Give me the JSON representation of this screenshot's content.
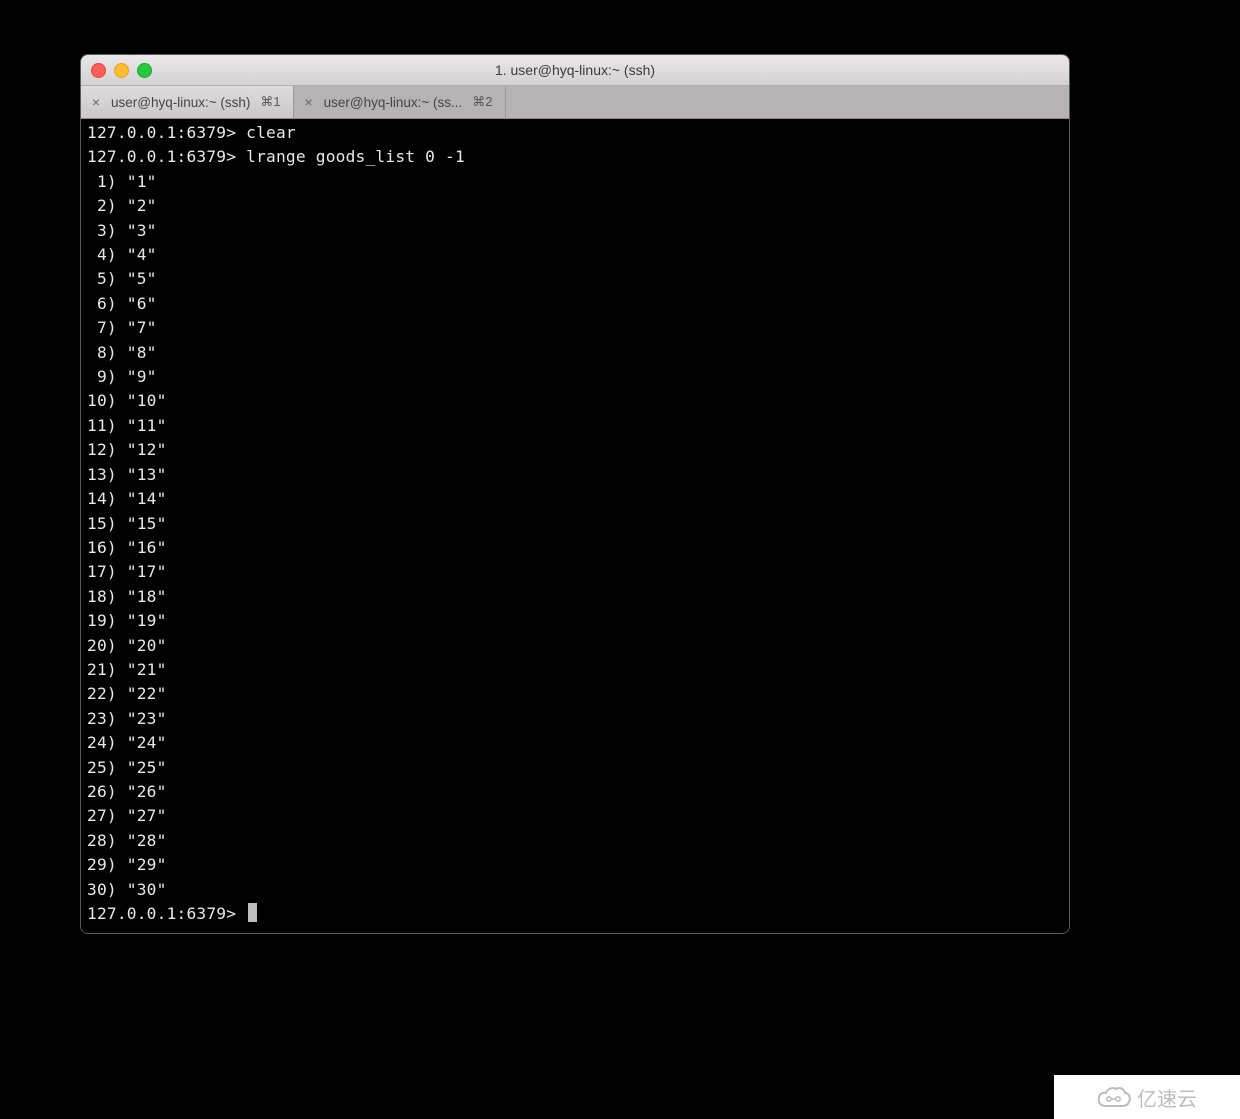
{
  "window": {
    "title": "1. user@hyq-linux:~ (ssh)"
  },
  "tabs": [
    {
      "label": "user@hyq-linux:~ (ssh)",
      "shortcut": "⌘1",
      "active": true
    },
    {
      "label": "user@hyq-linux:~ (ss...",
      "shortcut": "⌘2",
      "active": false
    }
  ],
  "terminal": {
    "prompt": "127.0.0.1:6379>",
    "commands": [
      {
        "cmd": "clear"
      },
      {
        "cmd": "lrange goods_list 0 -1"
      }
    ],
    "output": [
      {
        "idx": "1",
        "val": "1"
      },
      {
        "idx": "2",
        "val": "2"
      },
      {
        "idx": "3",
        "val": "3"
      },
      {
        "idx": "4",
        "val": "4"
      },
      {
        "idx": "5",
        "val": "5"
      },
      {
        "idx": "6",
        "val": "6"
      },
      {
        "idx": "7",
        "val": "7"
      },
      {
        "idx": "8",
        "val": "8"
      },
      {
        "idx": "9",
        "val": "9"
      },
      {
        "idx": "10",
        "val": "10"
      },
      {
        "idx": "11",
        "val": "11"
      },
      {
        "idx": "12",
        "val": "12"
      },
      {
        "idx": "13",
        "val": "13"
      },
      {
        "idx": "14",
        "val": "14"
      },
      {
        "idx": "15",
        "val": "15"
      },
      {
        "idx": "16",
        "val": "16"
      },
      {
        "idx": "17",
        "val": "17"
      },
      {
        "idx": "18",
        "val": "18"
      },
      {
        "idx": "19",
        "val": "19"
      },
      {
        "idx": "20",
        "val": "20"
      },
      {
        "idx": "21",
        "val": "21"
      },
      {
        "idx": "22",
        "val": "22"
      },
      {
        "idx": "23",
        "val": "23"
      },
      {
        "idx": "24",
        "val": "24"
      },
      {
        "idx": "25",
        "val": "25"
      },
      {
        "idx": "26",
        "val": "26"
      },
      {
        "idx": "27",
        "val": "27"
      },
      {
        "idx": "28",
        "val": "28"
      },
      {
        "idx": "29",
        "val": "29"
      },
      {
        "idx": "30",
        "val": "30"
      }
    ]
  },
  "watermark": {
    "text": "亿速云"
  }
}
